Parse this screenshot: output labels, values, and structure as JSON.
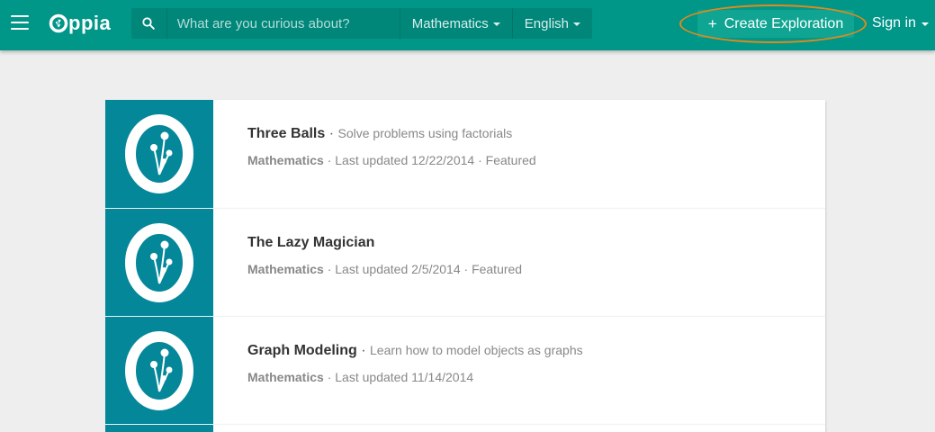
{
  "header": {
    "logo_text": "ppia",
    "search": {
      "placeholder": "What are you curious about?",
      "value": ""
    },
    "category_dropdown": "Mathematics",
    "language_dropdown": "English",
    "create_button": "Create Exploration",
    "create_button_icon": "+",
    "signin": "Sign in",
    "colors": {
      "navbar": "#009688",
      "highlight_ring": "#e08a1e"
    }
  },
  "explorations": [
    {
      "title": "Three Balls",
      "separator": "·",
      "objective": "Solve problems using factorials",
      "category": "Mathematics",
      "updated": "Last updated 12/22/2014",
      "featured": "Featured"
    },
    {
      "title": "The Lazy Magician",
      "separator": "",
      "objective": "",
      "category": "Mathematics",
      "updated": "Last updated 2/5/2014",
      "featured": "Featured"
    },
    {
      "title": "Graph Modeling",
      "separator": "·",
      "objective": "Learn how to model objects as graphs",
      "category": "Mathematics",
      "updated": "Last updated 11/14/2014",
      "featured": ""
    }
  ],
  "thumbnail_color": "#05879a"
}
